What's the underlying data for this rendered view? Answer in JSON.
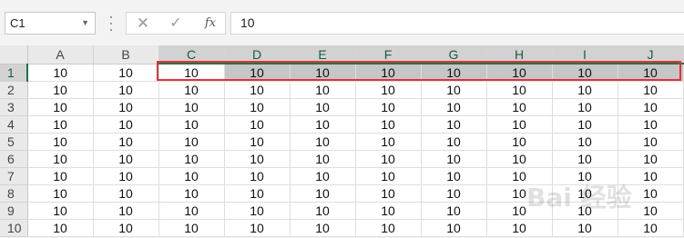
{
  "formula_bar": {
    "name_box": "C1",
    "cancel_symbol": "✕",
    "enter_symbol": "✓",
    "fx_symbol": "fx",
    "formula_value": "10"
  },
  "grid": {
    "columns": [
      "A",
      "B",
      "C",
      "D",
      "E",
      "F",
      "G",
      "H",
      "I",
      "J"
    ],
    "selected_columns": [
      "C",
      "D",
      "E",
      "F",
      "G",
      "H",
      "I",
      "J"
    ],
    "active_cell": "C1",
    "rows": [
      {
        "label": "1",
        "values": [
          "10",
          "10",
          "10",
          "10",
          "10",
          "10",
          "10",
          "10",
          "10",
          "10"
        ]
      },
      {
        "label": "2",
        "values": [
          "10",
          "10",
          "10",
          "10",
          "10",
          "10",
          "10",
          "10",
          "10",
          "10"
        ]
      },
      {
        "label": "3",
        "values": [
          "10",
          "10",
          "10",
          "10",
          "10",
          "10",
          "10",
          "10",
          "10",
          "10"
        ]
      },
      {
        "label": "4",
        "values": [
          "10",
          "10",
          "10",
          "10",
          "10",
          "10",
          "10",
          "10",
          "10",
          "10"
        ]
      },
      {
        "label": "5",
        "values": [
          "10",
          "10",
          "10",
          "10",
          "10",
          "10",
          "10",
          "10",
          "10",
          "10"
        ]
      },
      {
        "label": "6",
        "values": [
          "10",
          "10",
          "10",
          "10",
          "10",
          "10",
          "10",
          "10",
          "10",
          "10"
        ]
      },
      {
        "label": "7",
        "values": [
          "10",
          "10",
          "10",
          "10",
          "10",
          "10",
          "10",
          "10",
          "10",
          "10"
        ]
      },
      {
        "label": "8",
        "values": [
          "10",
          "10",
          "10",
          "10",
          "10",
          "10",
          "10",
          "10",
          "10",
          "10"
        ]
      },
      {
        "label": "9",
        "values": [
          "10",
          "10",
          "10",
          "10",
          "10",
          "10",
          "10",
          "10",
          "10",
          "10"
        ]
      },
      {
        "label": "10",
        "values": [
          "10",
          "10",
          "10",
          "10",
          "10",
          "10",
          "10",
          "10",
          "10",
          "10"
        ]
      }
    ]
  },
  "watermark": {
    "text": "Bai 经验"
  },
  "colors": {
    "selection_green": "#217346",
    "highlight_red": "#e5303a",
    "selected_fill": "#c6c6c6"
  }
}
